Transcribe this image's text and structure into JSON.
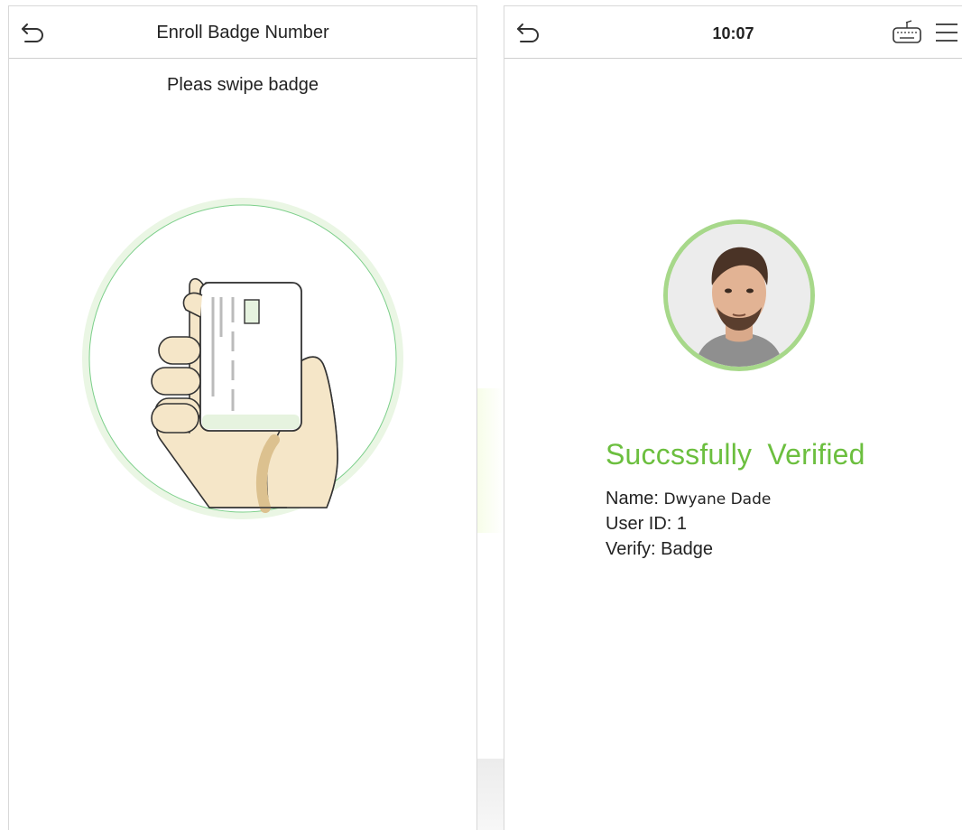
{
  "left_screen": {
    "title": "Enroll Badge Number",
    "prompt": "Pleas swipe badge",
    "back_icon": "back-arrow-icon",
    "illustration_icon": "hand-holding-card-icon"
  },
  "right_screen": {
    "time": "10:07",
    "back_icon": "back-arrow-icon",
    "keyboard_icon": "keyboard-icon",
    "menu_icon": "hamburger-menu-icon",
    "avatar_icon": "user-photo-icon",
    "status": "Succssfully  Verified",
    "name_label": "Name: ",
    "name_value": "Dwyane Dade",
    "userid_label": "User ID: ",
    "userid_value": "1",
    "verify_label": "Verify: ",
    "verify_value": "Badge"
  },
  "colors": {
    "success_green": "#6cbf3f",
    "circle_light_green": "#eaf6e4",
    "avatar_ring": "#a7d88a",
    "divider": "#cfcfcf"
  }
}
